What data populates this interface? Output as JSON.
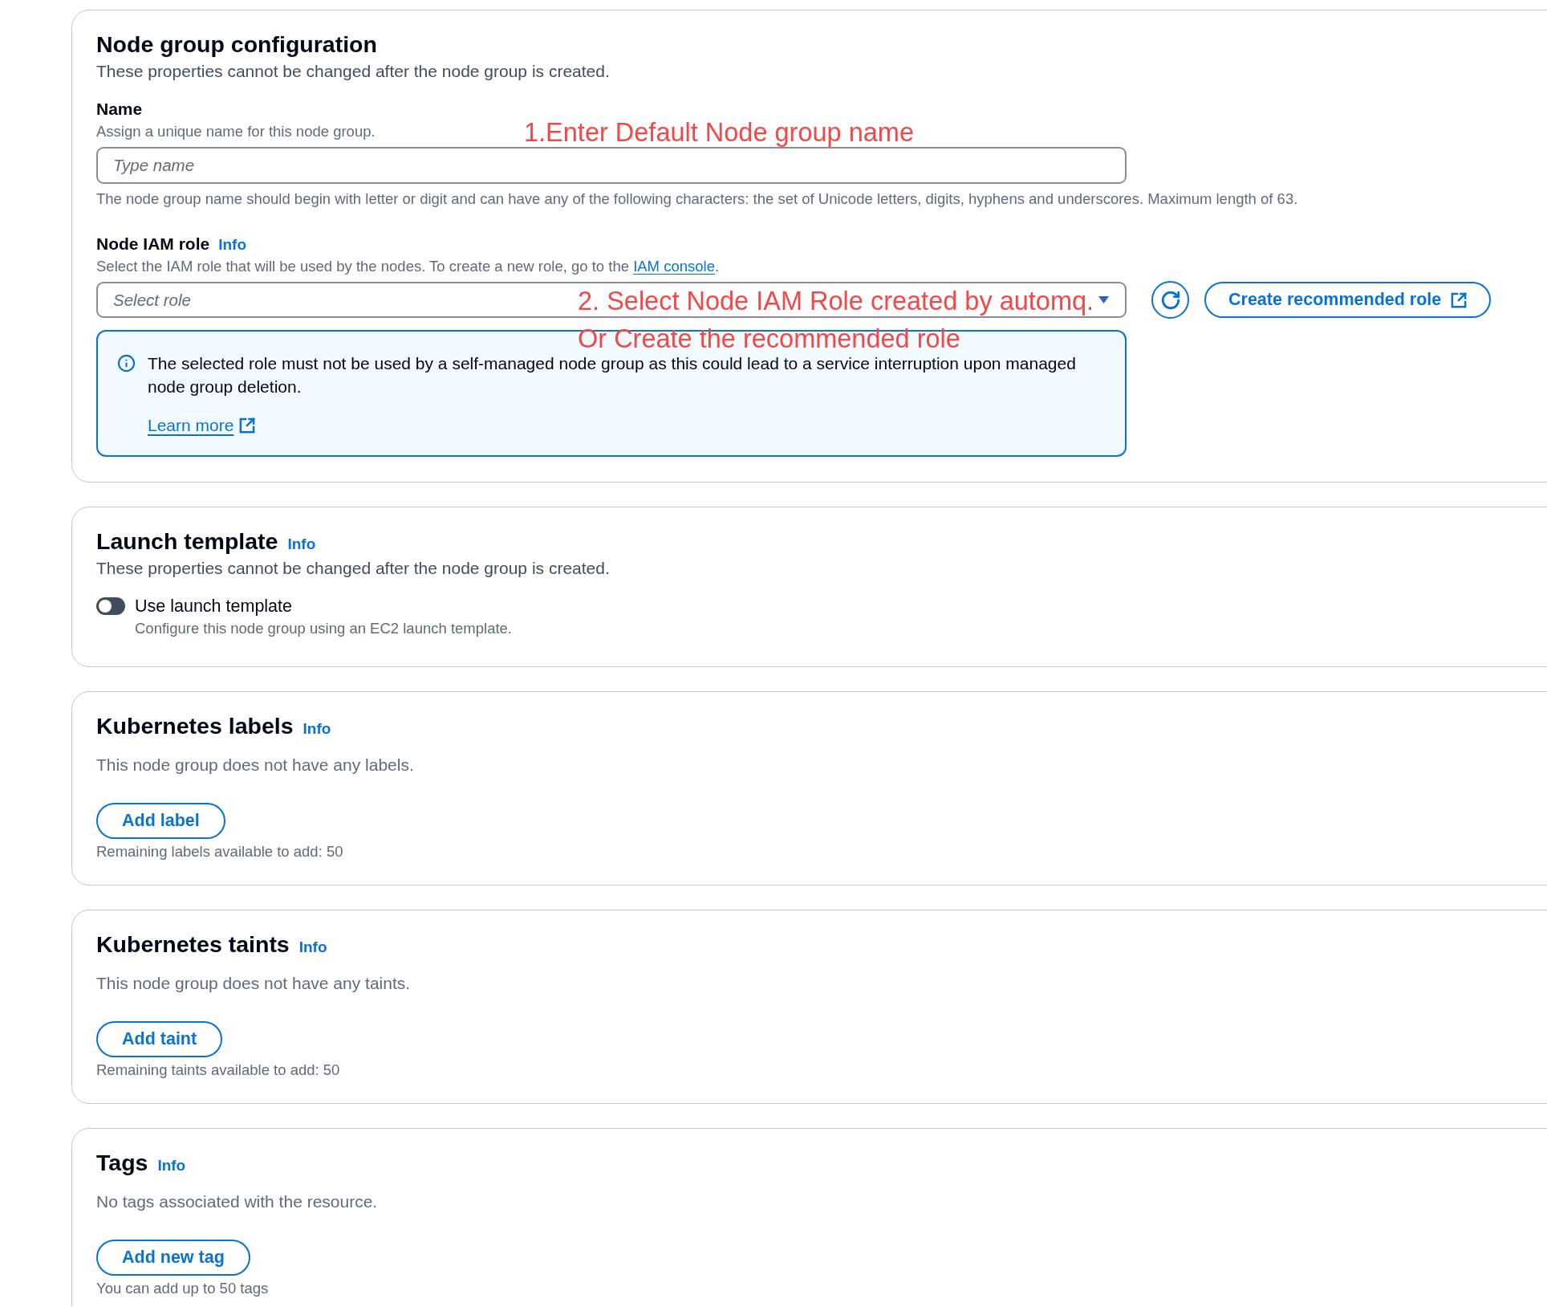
{
  "node_group_configuration": {
    "title": "Node group configuration",
    "description": "These properties cannot be changed after the node group is created.",
    "name_field": {
      "label": "Name",
      "description": "Assign a unique name for this node group.",
      "placeholder": "Type name",
      "constraint": "The node group name should begin with letter or digit and can have any of the following characters: the set of Unicode letters, digits, hyphens and underscores. Maximum length of 63."
    },
    "iam_role_field": {
      "label": "Node IAM role",
      "info": "Info",
      "description": "Select the IAM role that will be used by the nodes. To create a new role, go to the",
      "description_link": "IAM console",
      "description_end": ".",
      "placeholder": "Select role",
      "create_button": "Create recommended role"
    },
    "alert": {
      "text": "The selected role must not be used by a self-managed node group as this could lead to a service interruption upon managed node group deletion.",
      "link": "Learn more"
    }
  },
  "launch_template": {
    "title": "Launch template",
    "info": "Info",
    "description": "These properties cannot be changed after the node group is created.",
    "toggle": {
      "label": "Use launch template",
      "description": "Configure this node group using an EC2 launch template.",
      "on": false
    }
  },
  "list_sections": [
    {
      "title": "Kubernetes labels",
      "info": "Info",
      "empty_text": "This node group does not have any labels.",
      "add_button": "Add label",
      "remaining": "Remaining labels available to add: 50"
    },
    {
      "title": "Kubernetes taints",
      "info": "Info",
      "empty_text": "This node group does not have any taints.",
      "add_button": "Add taint",
      "remaining": "Remaining taints available to add: 50"
    },
    {
      "title": "Tags",
      "info": "Info",
      "empty_text": "No tags associated with the resource.",
      "add_button": "Add new tag",
      "remaining": "You can add up to 50 tags"
    }
  ],
  "annotations": [
    {
      "text": "1.Enter Default Node group name"
    },
    {
      "text": "2. Select Node IAM Role created by automq."
    },
    {
      "text": "Or Create the recommended role"
    }
  ]
}
